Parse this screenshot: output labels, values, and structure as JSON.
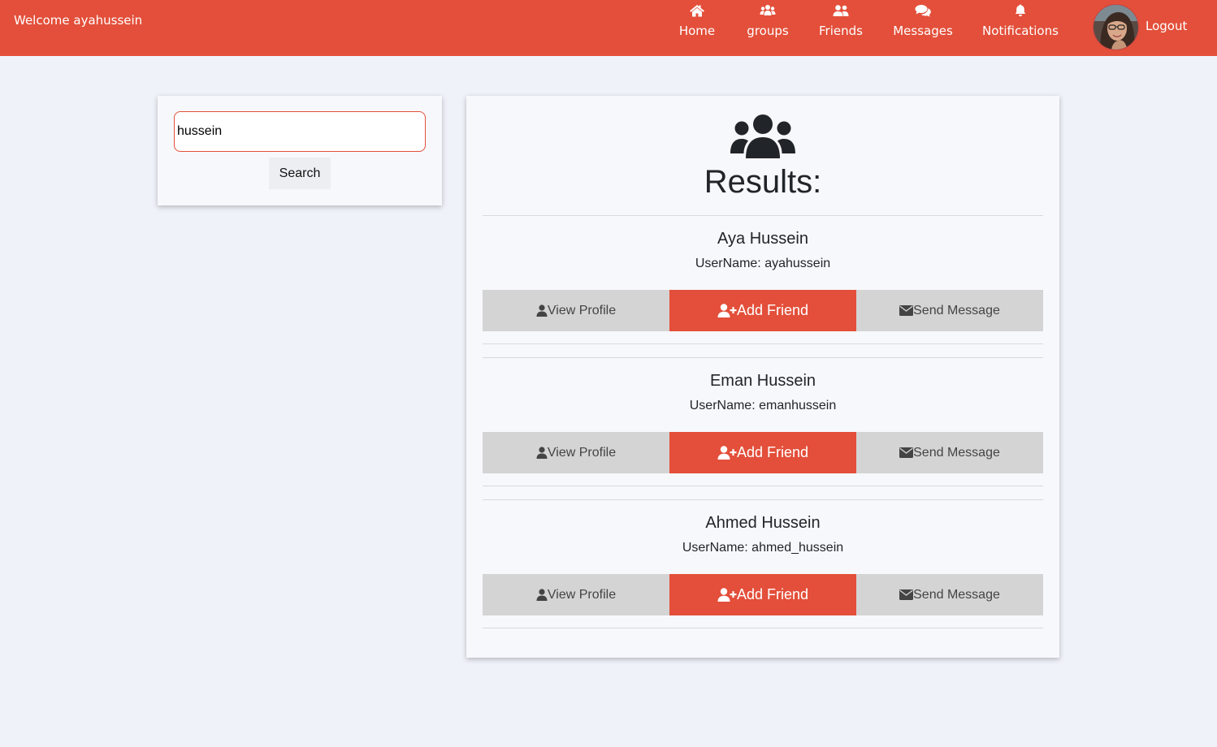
{
  "header": {
    "welcome_text": "Welcome ayahussein",
    "nav": [
      {
        "label": "Home",
        "icon": "home-icon"
      },
      {
        "label": "groups",
        "icon": "users-icon"
      },
      {
        "label": "Friends",
        "icon": "user-friends-icon"
      },
      {
        "label": "Messages",
        "icon": "comments-icon"
      },
      {
        "label": "Notifications",
        "icon": "bell-icon"
      }
    ],
    "logout_label": "Logout",
    "avatar_icon": "profile-avatar"
  },
  "search": {
    "value": "hussein",
    "button_label": "Search"
  },
  "results": {
    "title": "Results:",
    "icon": "users-icon",
    "items": [
      {
        "name": "Aya Hussein",
        "username_text": "UserName: ayahussein"
      },
      {
        "name": "Eman Hussein",
        "username_text": "UserName: emanhussein"
      },
      {
        "name": "Ahmed Hussein",
        "username_text": "UserName: ahmed_hussein"
      }
    ],
    "view_profile_label": "View Profile",
    "add_friend_label": "Add Friend",
    "send_message_label": "Send Message"
  },
  "colors": {
    "accent": "#e34f3a",
    "background": "#eff2f9",
    "button_gray": "#d4d4d4"
  }
}
